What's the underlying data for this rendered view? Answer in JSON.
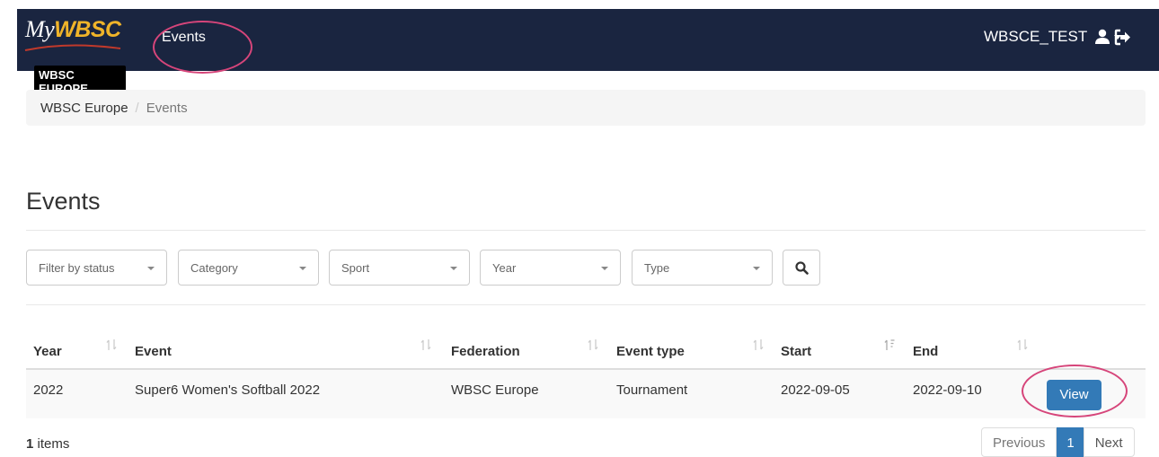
{
  "header": {
    "logo_my": "My",
    "logo_wbsc": "WBSC",
    "logo_badge": "WBSC EUROPE",
    "nav_events": "Events",
    "username": "WBSCE_TEST"
  },
  "breadcrumb": {
    "home": "WBSC Europe",
    "separator": "/",
    "current": "Events"
  },
  "page": {
    "title": "Events"
  },
  "filters": {
    "status": "Filter by status",
    "category": "Category",
    "sport": "Sport",
    "year": "Year",
    "type": "Type"
  },
  "table": {
    "columns": [
      "Year",
      "Event",
      "Federation",
      "Event type",
      "Start",
      "End"
    ],
    "rows": [
      {
        "year": "2022",
        "event": "Super6 Women's Softball 2022",
        "federation": "WBSC Europe",
        "event_type": "Tournament",
        "start": "2022-09-05",
        "end": "2022-09-10",
        "action": "View"
      }
    ]
  },
  "footer": {
    "items_count": "1",
    "items_label": " items",
    "pager_prev": "Previous",
    "pager_current": "1",
    "pager_next": "Next"
  },
  "colors": {
    "navbar": "#1a2540",
    "brand_gold": "#f0b429",
    "primary": "#337ab7",
    "annotation": "#d6457a"
  }
}
